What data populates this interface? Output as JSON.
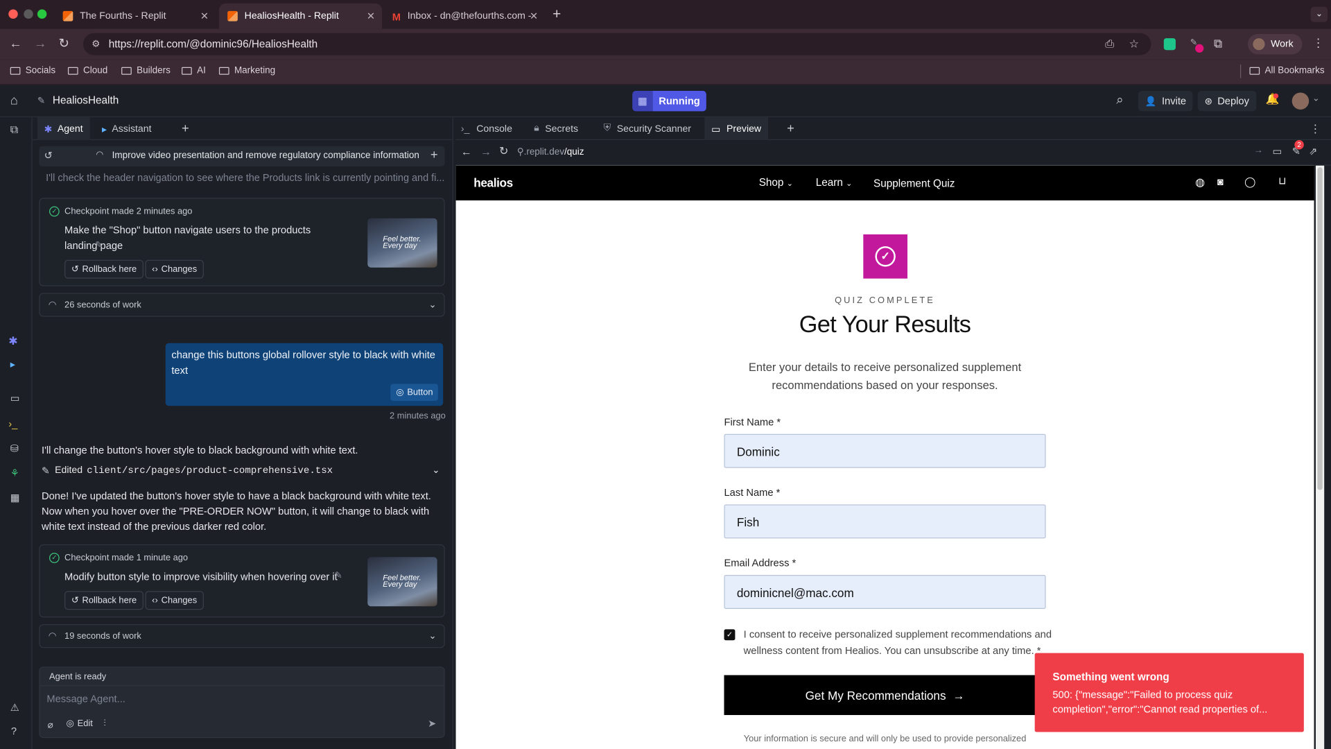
{
  "browser": {
    "tabs": [
      {
        "label": "The Fourths - Replit"
      },
      {
        "label": "HealiosHealth - Replit"
      },
      {
        "label": "Inbox - dn@thefourths.com -"
      }
    ],
    "url": "https://replit.com/@dominic96/HealiosHealth",
    "profile": "Work",
    "bookmarks": [
      "Socials",
      "Cloud",
      "Builders",
      "AI",
      "Marketing"
    ],
    "all_bookmarks": "All Bookmarks",
    "ext_badge": ""
  },
  "replit": {
    "project": "HealiosHealth",
    "run_label": "Running",
    "invite": "Invite",
    "deploy": "Deploy"
  },
  "agent": {
    "tabs": [
      "Agent",
      "Assistant"
    ],
    "thread_title": "Improve video presentation and remove regulatory compliance information",
    "faded_line": "I'll check the header navigation to see where the Products link is currently pointing and fi...",
    "checkpoint1": {
      "meta": "Checkpoint made 2 minutes ago",
      "title": "Make the \"Shop\" button navigate users to the products landing page",
      "rollback": "Rollback here",
      "changes": "Changes"
    },
    "work1": "26 seconds of work",
    "user_msg": "change this buttons global rollover style to black with white text",
    "user_tag": "Button",
    "user_time": "2 minutes ago",
    "reply1": "I'll change the button's hover style to black background with white text.",
    "edited_label": "Edited",
    "edited_file": "client/src/pages/product-comprehensive.tsx",
    "reply2": "Done! I've updated the button's hover style to have a black background with white text. Now when you hover over the \"PRE-ORDER NOW\" button, it will change to black with white text instead of the previous darker red color.",
    "checkpoint2": {
      "meta": "Checkpoint made 1 minute ago",
      "title": "Modify button style to improve visibility when hovering over it",
      "rollback": "Rollback here",
      "changes": "Changes"
    },
    "work2": "19 seconds of work",
    "status": "Agent is ready",
    "input_placeholder": "Message Agent...",
    "edit_label": "Edit",
    "thumb_text": "Feel better. Every day"
  },
  "workspace": {
    "tabs": [
      "Console",
      "Secrets",
      "Security Scanner",
      "Preview"
    ],
    "preview_host": ".replit.dev",
    "preview_path": "/quiz",
    "notif_count": "2"
  },
  "site": {
    "logo": "healios",
    "nav": [
      "Shop",
      "Learn",
      "Supplement Quiz"
    ],
    "eyebrow": "QUIZ COMPLETE",
    "heading": "Get Your Results",
    "subtext_line1": "Enter your details to receive personalized supplement",
    "subtext_line2": "recommendations based on your responses.",
    "first_label": "First Name *",
    "first_value": "Dominic",
    "last_label": "Last Name *",
    "last_value": "Fish",
    "email_label": "Email Address *",
    "email_value": "dominicnel@mac.com",
    "consent_line1": "I consent to receive personalized supplement recommendations and",
    "consent_line2": "wellness content from Healios. You can unsubscribe at any time. *",
    "cta": "Get My Recommendations",
    "footnote": "Your information is secure and will only be used to provide personalized",
    "brand_color": "#c2189b"
  },
  "toast": {
    "title": "Something went wrong",
    "line1": "500: {\"message\":\"Failed to process quiz",
    "line2": "completion\",\"error\":\"Cannot read properties of..."
  }
}
